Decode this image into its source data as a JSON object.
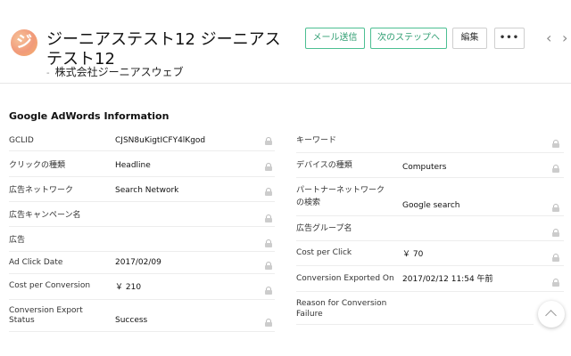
{
  "header": {
    "avatar_letter": "ジ",
    "title": "ジーニアステスト12 ジーニアステスト12",
    "subtitle_dash": "-",
    "company": "株式会社ジーニアスウェブ",
    "buttons": {
      "send_mail": "メール送信",
      "next_step": "次のステップへ",
      "edit": "編集",
      "more": "•••"
    },
    "nav": {
      "prev": "‹",
      "next": "›"
    }
  },
  "section": {
    "title": "Google AdWords Information",
    "left_fields": [
      {
        "label": "GCLID",
        "value": "CJSN8uKigtICFY4lKgod"
      },
      {
        "label": "クリックの種類",
        "value": "Headline"
      },
      {
        "label": "広告ネットワーク",
        "value": "Search Network"
      },
      {
        "label": "広告キャンペーン名",
        "value": ""
      },
      {
        "label": "広告",
        "value": ""
      },
      {
        "label": "Ad Click Date",
        "value": "2017/02/09"
      },
      {
        "label": "Cost per Conversion",
        "value": "￥ 210"
      },
      {
        "label": "Conversion Export",
        "label2": "Status",
        "value": "Success"
      }
    ],
    "right_fields": [
      {
        "label": "キーワード",
        "value": ""
      },
      {
        "label": "デバイスの種類",
        "value": "Computers"
      },
      {
        "label": "パートナーネットワーク",
        "label2": "の検索",
        "value": "Google search"
      },
      {
        "label": "広告グループ名",
        "value": ""
      },
      {
        "label": "Cost per Click",
        "value": "￥ 70"
      },
      {
        "label": "Conversion Exported On",
        "value": "2017/02/12 11:54 午前"
      },
      {
        "label": "Reason for Conversion",
        "label2": "Failure",
        "value": ""
      }
    ]
  }
}
